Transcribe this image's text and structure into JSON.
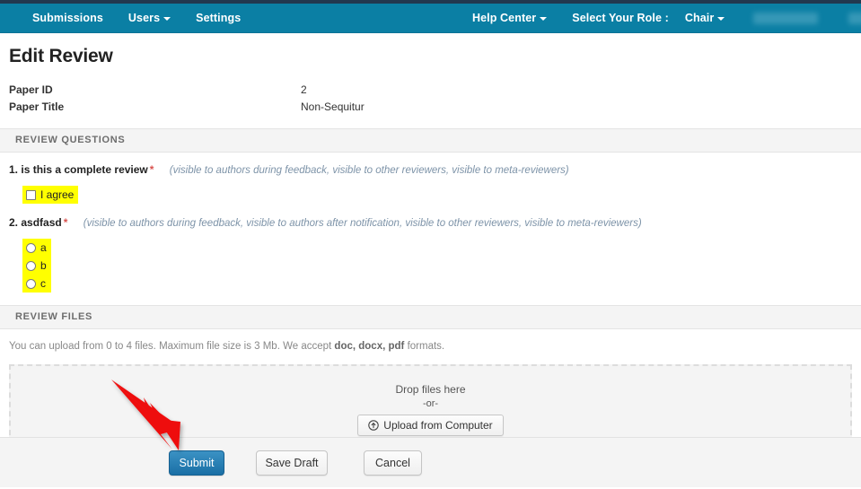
{
  "navbar": {
    "left_items": [
      {
        "label": "Submissions",
        "caret": false,
        "name": "nav-submissions"
      },
      {
        "label": "Users",
        "caret": true,
        "name": "nav-users"
      },
      {
        "label": "Settings",
        "caret": false,
        "name": "nav-settings"
      }
    ],
    "help_center": "Help Center",
    "role_prompt": "Select Your Role :",
    "role_value": "Chair",
    "background_color": "#0b7fa4",
    "topstrip_color": "#22384f"
  },
  "page": {
    "title": "Edit Review"
  },
  "meta": {
    "rows": [
      {
        "label": "Paper ID",
        "value": "2"
      },
      {
        "label": "Paper Title",
        "value": "Non-Sequitur"
      }
    ]
  },
  "review_questions": {
    "section_title": "REVIEW QUESTIONS",
    "required_marker": "*",
    "items": [
      {
        "number": "1.",
        "text": "is this a complete review",
        "visibility": "(visible to authors during feedback, visible to other reviewers, visible to meta-reviewers)",
        "input_type": "checkbox",
        "options": [
          {
            "label": "I agree",
            "checked": false
          }
        ]
      },
      {
        "number": "2.",
        "text": "asdfasd",
        "visibility": "(visible to authors during feedback, visible to authors after notification, visible to other reviewers, visible to meta-reviewers)",
        "input_type": "radio",
        "options": [
          {
            "label": "a",
            "checked": false
          },
          {
            "label": "b",
            "checked": false
          },
          {
            "label": "c",
            "checked": false
          }
        ]
      }
    ],
    "highlight_color": "#ffff00"
  },
  "review_files": {
    "section_title": "REVIEW FILES",
    "note_prefix": "You can upload from 0 to 4 files. Maximum file size is 3 Mb. We accept ",
    "note_formats": "doc, docx, pdf",
    "note_suffix": " formats.",
    "dropzone": {
      "drop_text": "Drop files here",
      "or_text": "-or-",
      "upload_button": "Upload from Computer",
      "upload_icon": "upload-circle-icon"
    }
  },
  "footer": {
    "submit_label": "Submit",
    "save_draft_label": "Save Draft",
    "cancel_label": "Cancel",
    "submit_color": "#1a6fa5"
  },
  "annotation": {
    "arrow_color": "#ee1111",
    "arrow_target": "submit-button"
  }
}
